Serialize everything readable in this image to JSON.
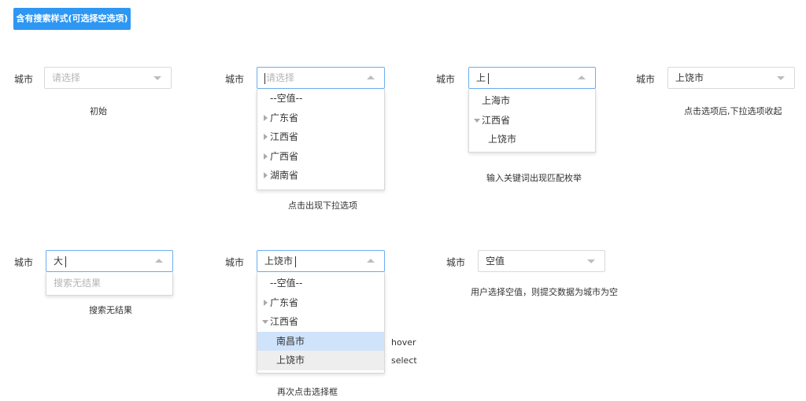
{
  "header": {
    "button_label": "含有搜索样式(可选择空选项)"
  },
  "accent_color": "#2d97f3",
  "field_label": "城市",
  "demos": [
    {
      "id": "initial",
      "value": "",
      "placeholder": "请选择",
      "caption": "初始"
    },
    {
      "id": "open",
      "value": "",
      "placeholder": "请选择",
      "caption": "点击出现下拉选项",
      "options": [
        "--空值--",
        "广东省",
        "江西省",
        "广西省",
        "湖南省"
      ]
    },
    {
      "id": "keyword",
      "value": "上",
      "caption": "输入关键词出现匹配枚举",
      "options": [
        "上海市",
        "江西省",
        "上饶市"
      ]
    },
    {
      "id": "collapsed",
      "value": "上饶市",
      "caption": "点击选项后,下拉选项收起"
    },
    {
      "id": "no-result",
      "value": "大",
      "caption": "搜索无结果",
      "empty_text": "搜索无结果"
    },
    {
      "id": "reopen",
      "value": "上饶市",
      "caption": "再次点击选择框",
      "options": [
        "--空值--",
        "广东省",
        "江西省",
        "南昌市",
        "上饶市"
      ],
      "hover_note": "hover",
      "select_note": "select"
    },
    {
      "id": "empty-value",
      "value": "空值",
      "caption": "用户选择空值，则提交数据为城市为空"
    }
  ]
}
